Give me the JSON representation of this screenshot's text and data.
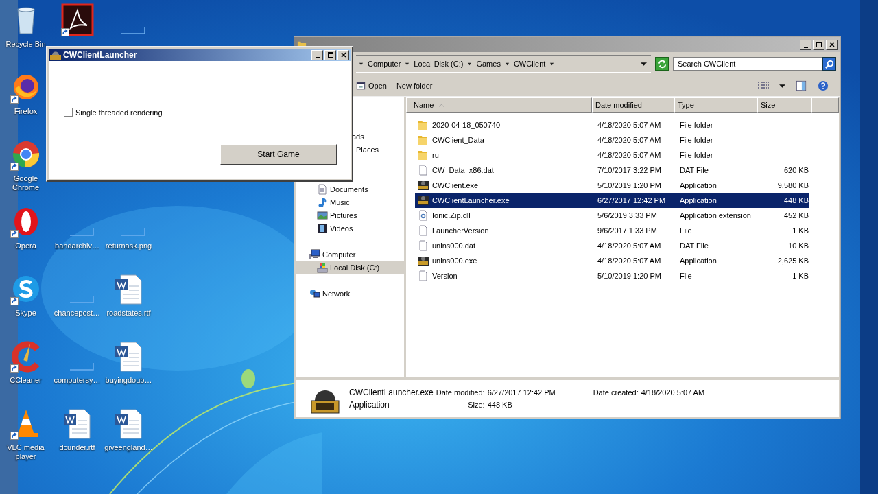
{
  "desktop": {
    "columns": [
      [
        {
          "label": "Recycle Bin",
          "kind": "recycle",
          "shortcut": false
        },
        {
          "label": "Firefox",
          "kind": "firefox",
          "shortcut": true
        },
        {
          "label": "Google Chrome",
          "kind": "chrome",
          "shortcut": true
        },
        {
          "label": "Opera",
          "kind": "opera",
          "shortcut": true
        },
        {
          "label": "Skype",
          "kind": "skype",
          "shortcut": true
        },
        {
          "label": "CCleaner",
          "kind": "ccleaner",
          "shortcut": true
        },
        {
          "label": "VLC media player",
          "kind": "vlc",
          "shortcut": true
        }
      ],
      [
        {
          "kind": "acrobat",
          "shortcut": true
        },
        {
          "label": "bandarchiv…",
          "kind": "blank",
          "shortcut": false
        },
        {
          "label": "chancepost…",
          "kind": "blank",
          "shortcut": false
        },
        {
          "label": "computersy…",
          "kind": "blank",
          "shortcut": false
        },
        {
          "label": "dcunder.rtf",
          "kind": "word",
          "shortcut": false
        }
      ],
      [
        {
          "kind": "blank",
          "shortcut": false
        },
        {
          "label": "returnask.png",
          "kind": "blank",
          "shortcut": false
        },
        {
          "label": "roadstates.rtf",
          "kind": "word",
          "shortcut": false
        },
        {
          "label": "buyingdoub…",
          "kind": "word",
          "shortcut": false
        },
        {
          "label": "giveengland…",
          "kind": "word",
          "shortcut": false
        }
      ]
    ]
  },
  "explorer": {
    "breadcrumb": [
      "Computer",
      "Local Disk (C:)",
      "Games",
      "CWClient"
    ],
    "search": {
      "placeholder": "Search CWClient"
    },
    "toolbar": [
      "Open",
      "New folder"
    ],
    "nav": {
      "favorites": [
        "ads",
        "Places"
      ],
      "libraries": [
        {
          "label": "Documents",
          "kind": "documents"
        },
        {
          "label": "Music",
          "kind": "music"
        },
        {
          "label": "Pictures",
          "kind": "pictures"
        },
        {
          "label": "Videos",
          "kind": "videos"
        }
      ],
      "computer": {
        "label": "Computer",
        "children": [
          {
            "label": "Local Disk (C:)",
            "selected": true
          }
        ]
      },
      "network": {
        "label": "Network"
      }
    },
    "columns": [
      "Name",
      "Date modified",
      "Type",
      "Size"
    ],
    "rows": [
      {
        "name": "2020-04-18_050740",
        "date": "4/18/2020 5:07 AM",
        "type": "File folder",
        "size": "",
        "kind": "folder",
        "selected": false
      },
      {
        "name": "CWClient_Data",
        "date": "4/18/2020 5:07 AM",
        "type": "File folder",
        "size": "",
        "kind": "folder",
        "selected": false
      },
      {
        "name": "ru",
        "date": "4/18/2020 5:07 AM",
        "type": "File folder",
        "size": "",
        "kind": "folder",
        "selected": false
      },
      {
        "name": "CW_Data_x86.dat",
        "date": "7/10/2017 3:22 PM",
        "type": "DAT File",
        "size": "620 KB",
        "kind": "file",
        "selected": false
      },
      {
        "name": "CWClient.exe",
        "date": "5/10/2019 1:20 PM",
        "type": "Application",
        "size": "9,580 KB",
        "kind": "cw",
        "selected": false
      },
      {
        "name": "CWClientLauncher.exe",
        "date": "6/27/2017 12:42 PM",
        "type": "Application",
        "size": "448 KB",
        "kind": "cw",
        "selected": true
      },
      {
        "name": "Ionic.Zip.dll",
        "date": "5/6/2019 3:33 PM",
        "type": "Application extension",
        "size": "452 KB",
        "kind": "dll",
        "selected": false
      },
      {
        "name": "LauncherVersion",
        "date": "9/6/2017 1:33 PM",
        "type": "File",
        "size": "1 KB",
        "kind": "file",
        "selected": false
      },
      {
        "name": "unins000.dat",
        "date": "4/18/2020 5:07 AM",
        "type": "DAT File",
        "size": "10 KB",
        "kind": "file",
        "selected": false
      },
      {
        "name": "unins000.exe",
        "date": "4/18/2020 5:07 AM",
        "type": "Application",
        "size": "2,625 KB",
        "kind": "cw",
        "selected": false
      },
      {
        "name": "Version",
        "date": "5/10/2019 1:20 PM",
        "type": "File",
        "size": "1 KB",
        "kind": "file",
        "selected": false
      }
    ],
    "details": {
      "name": "CWClientLauncher.exe",
      "type": "Application",
      "modified_label": "Date modified:",
      "modified": "6/27/2017 12:42 PM",
      "created_label": "Date created:",
      "created": "4/18/2020 5:07 AM",
      "size_label": "Size:",
      "size": "448 KB"
    }
  },
  "launcher": {
    "title": "CWClientLauncher",
    "option": {
      "label": "Single threaded rendering",
      "checked": false
    },
    "button": "Start Game"
  }
}
